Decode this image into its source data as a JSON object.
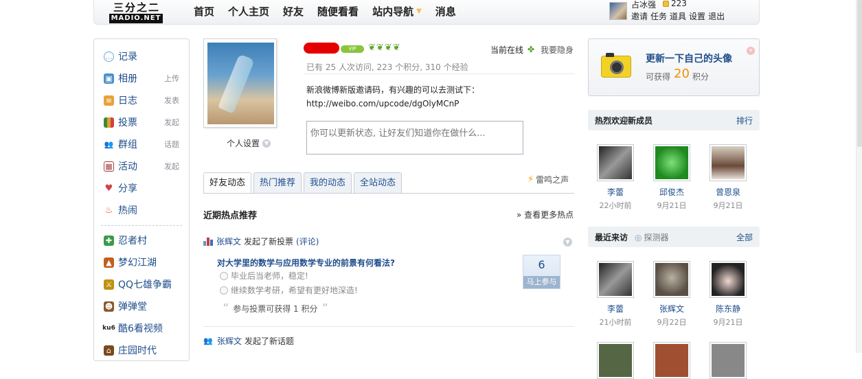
{
  "logo": {
    "line1": "三分之二",
    "line2": "MADIO.NET"
  },
  "nav": {
    "items": [
      "首页",
      "个人主页",
      "好友",
      "随便看看",
      "站内导航",
      "消息"
    ]
  },
  "user": {
    "name": "占冰强",
    "coins": "223",
    "links": [
      "邀请",
      "任务",
      "道具",
      "设置",
      "退出"
    ]
  },
  "sidebar": {
    "items": [
      {
        "label": "记录",
        "sub": "",
        "icon": "chat-bubble-icon",
        "color": "#6aa7d8"
      },
      {
        "label": "相册",
        "sub": "上传",
        "icon": "photo-album-icon",
        "color": "#4a90c8"
      },
      {
        "label": "日志",
        "sub": "发表",
        "icon": "journal-icon",
        "color": "#e8a23a"
      },
      {
        "label": "投票",
        "sub": "发起",
        "icon": "poll-chart-icon",
        "color": "#3a8a3a"
      },
      {
        "label": "群组",
        "sub": "话题",
        "icon": "group-icon",
        "color": "#3b6ea8"
      },
      {
        "label": "活动",
        "sub": "发起",
        "icon": "calendar-icon",
        "color": "#a04040"
      },
      {
        "label": "分享",
        "sub": "",
        "icon": "heart-share-icon",
        "color": "#d0404a"
      },
      {
        "label": "热闹",
        "sub": "",
        "icon": "flame-icon",
        "color": "#e2601e"
      }
    ],
    "games": [
      {
        "label": "忍者村",
        "icon": "ninja-village-icon",
        "color": "#3a9a4a"
      },
      {
        "label": "梦幻江湖",
        "icon": "fantasy-jianghu-icon",
        "color": "#c06020"
      },
      {
        "label": "QQ七雄争霸",
        "icon": "qq-seven-heroes-icon",
        "color": "#c09010"
      },
      {
        "label": "弹弹堂",
        "icon": "ddtank-icon",
        "color": "#8a5a2a"
      },
      {
        "label": "酷6看视频",
        "icon": "ku6-video-icon",
        "color": "#222222"
      },
      {
        "label": "庄园时代",
        "icon": "manor-era-icon",
        "color": "#7a4a1a"
      }
    ]
  },
  "profile": {
    "settings_label": "个人设置",
    "online_label": "当前在线",
    "hide_label": "我要隐身",
    "stats": "已有 25 人次访问, 223 个积分, 310 个经验",
    "status_text": "新浪微博新版邀请码，有兴趣的可以去测试下：http://weibo.com/upcode/dgOlyMCnP",
    "status_placeholder": "你可以更新状态, 让好友们知道你在做什么..."
  },
  "tabs": [
    "好友动态",
    "热门推荐",
    "我的动态",
    "全站动态"
  ],
  "thunder_label": "雷鸣之声",
  "feed": {
    "hot_label": "近期热点推荐",
    "more_label": "» 查看更多热点",
    "poll": {
      "user": "张辉文",
      "action": "发起了新投票",
      "comment": "(评论)",
      "question": "对大学里的数学与应用数学专业的前景有何看法?",
      "options": [
        "毕业后当老师，稳定!",
        "继续数学考研，希望有更好地深造!"
      ],
      "reward": "参与投票可获得 1 积分",
      "count": "6",
      "join_label": "马上参与"
    },
    "topic": {
      "user": "张辉文",
      "action": "发起了新话题"
    }
  },
  "avatar_panel": {
    "title": "更新一下自己的头像",
    "get_label": "可获得",
    "points": "20",
    "unit": "积分"
  },
  "new_members": {
    "title": "热烈欢迎新成员",
    "link": "排行",
    "items": [
      {
        "name": "李蕾",
        "time": "22小时前"
      },
      {
        "name": "邱俊杰",
        "time": "9月21日"
      },
      {
        "name": "曾恩泉",
        "time": "9月21日"
      }
    ]
  },
  "visitors": {
    "title": "最近来访",
    "extra": "探测器",
    "link": "全部",
    "items": [
      {
        "name": "李蕾",
        "time": "21小时前"
      },
      {
        "name": "张辉文",
        "time": "9月22日"
      },
      {
        "name": "陈东静",
        "time": "9月21日"
      }
    ]
  }
}
